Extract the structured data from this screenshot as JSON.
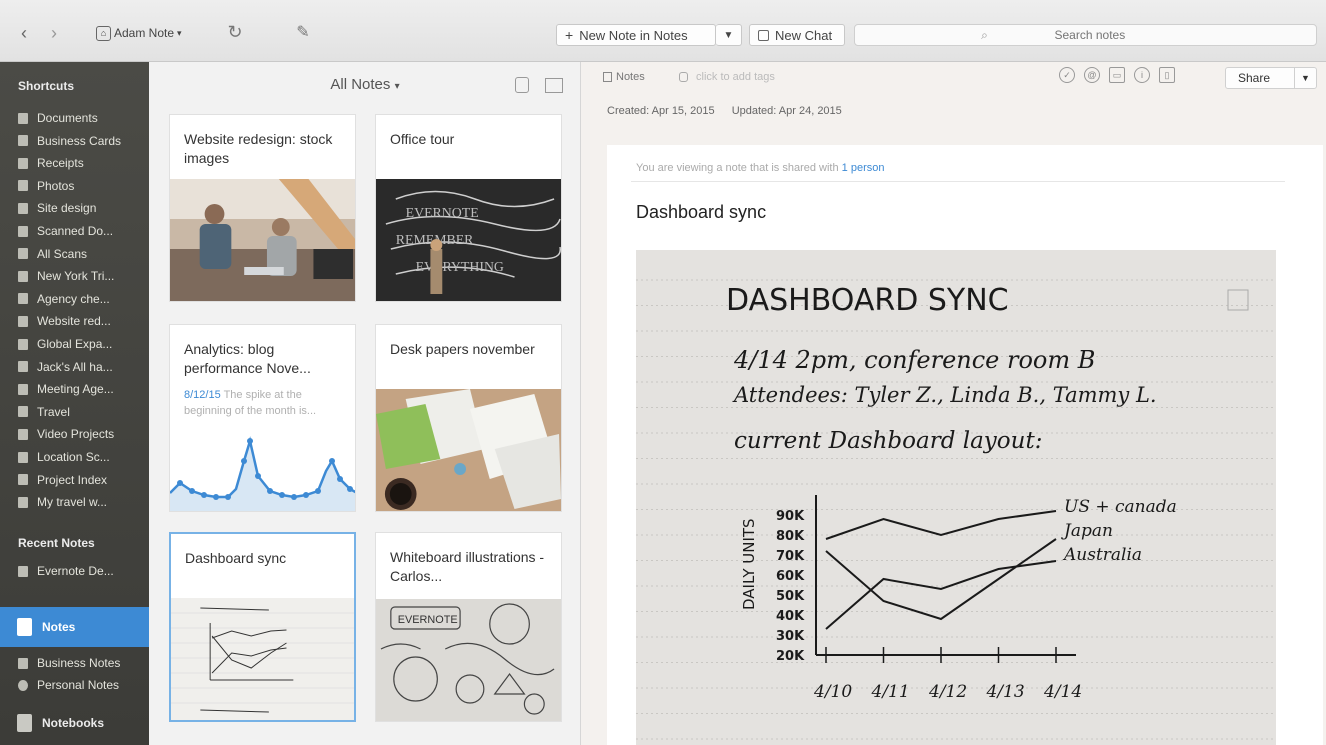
{
  "toolbar": {
    "back_icon": "chevron-left-icon",
    "forward_icon": "chevron-right-icon",
    "account_label": "Adam Note",
    "account_caret": "▾",
    "new_note_label": "New Note in Notes",
    "new_chat_label": "New Chat",
    "search_placeholder": "Search notes"
  },
  "sidebar": {
    "shortcuts_heading": "Shortcuts",
    "shortcuts": [
      "Documents",
      "Business Cards",
      "Receipts",
      "Photos",
      "Site design",
      "Scanned Do...",
      "All Scans",
      "New York Tri...",
      "Agency che...",
      "Website red...",
      "Global Expa...",
      "Jack's All ha...",
      "Meeting Age...",
      "Travel",
      "Video Projects",
      "Location Sc...",
      "Project Index",
      "My travel w..."
    ],
    "recent_heading": "Recent Notes",
    "recent": [
      "Evernote De..."
    ],
    "notes_label": "Notes",
    "notebooks": [
      "Business Notes",
      "Personal Notes"
    ],
    "notebooks_label": "Notebooks"
  },
  "notelist": {
    "title": "All Notes",
    "caret": "▾",
    "cards": [
      {
        "title": "Website redesign: stock images"
      },
      {
        "title": "Office tour"
      },
      {
        "title": "Analytics: blog performance Nove...",
        "date": "8/12/15",
        "snippet": "The spike at the beginning of the month is..."
      },
      {
        "title": "Desk papers november"
      },
      {
        "title": "Dashboard sync"
      },
      {
        "title": "Whiteboard illustrations - Carlos..."
      }
    ]
  },
  "note": {
    "notebook": "Notes",
    "tags_placeholder": "click to add tags",
    "created": "Created: Apr 15, 2015",
    "updated": "Updated: Apr 24, 2015",
    "share_label": "Share",
    "shared_prefix": "You are viewing a note that is shared with",
    "shared_link": "1 person",
    "title": "Dashboard sync",
    "handwriting": {
      "heading": "DASHBOARD SYNC",
      "line1": "4/14  2pm, conference room B",
      "line2": "Attendees: Tyler Z., Linda B., Tammy L.",
      "line3": "current Dashboard layout:"
    },
    "chart_data": {
      "type": "line",
      "title": "",
      "ylabel": "DAILY UNITS",
      "xlabel": "",
      "categories": [
        "4/10",
        "4/11",
        "4/12",
        "4/13",
        "4/14"
      ],
      "yticks": [
        "20K",
        "30K",
        "40K",
        "50K",
        "60K",
        "70K",
        "80K",
        "90K"
      ],
      "ylim": [
        20,
        95
      ],
      "series": [
        {
          "name": "US + canada",
          "values": [
            78,
            88,
            80,
            88,
            92
          ]
        },
        {
          "name": "Japan",
          "values": [
            72,
            47,
            38,
            58,
            78
          ]
        },
        {
          "name": "Australia",
          "values": [
            33,
            58,
            53,
            63,
            67
          ]
        }
      ]
    }
  }
}
